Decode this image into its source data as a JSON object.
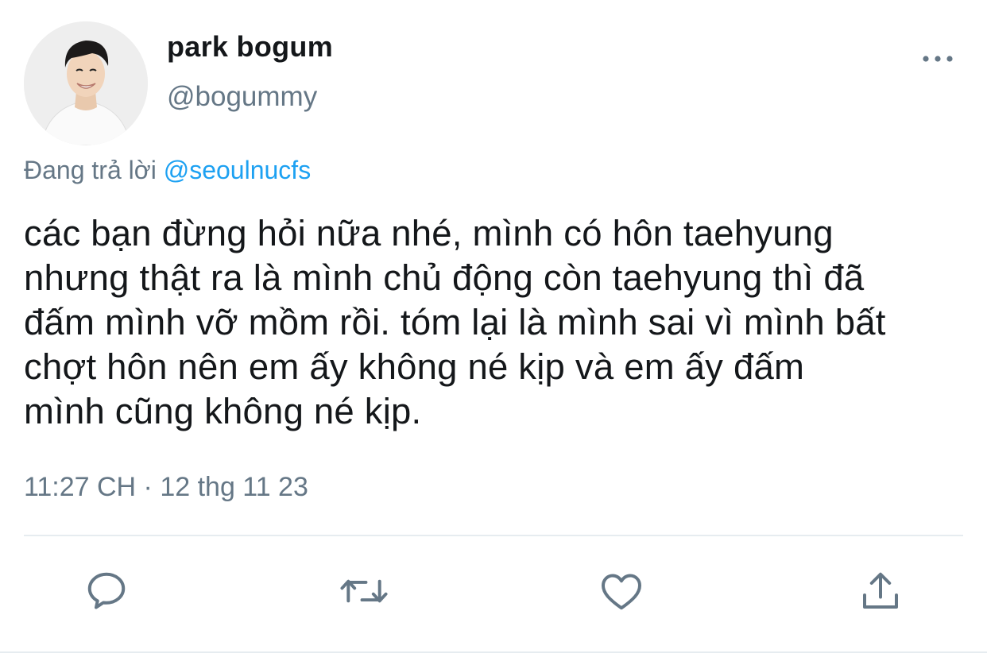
{
  "author": {
    "display_name": "park bogum",
    "handle": "@bogummy"
  },
  "reply": {
    "prefix": "Đang trả lời",
    "mention": "@seoulnucfs"
  },
  "tweet": {
    "text": "các bạn đừng hỏi nữa nhé, mình có hôn taehyung\nnhưng thật ra là mình chủ động còn taehyung thì đã\nđấm mình vỡ mồm rồi. tóm lại là mình sai vì mình bất\nchợt hôn nên em ấy không né kịp và em ấy đấm\nmình cũng không né kịp.",
    "timestamp": "11:27 CH · 12 thg 11 23"
  },
  "actions": {
    "icons": [
      "reply-icon",
      "retweet-icon",
      "like-icon",
      "share-icon"
    ]
  },
  "colors": {
    "text_primary": "#14171a",
    "text_secondary": "#657786",
    "accent": "#1da1f2",
    "divider": "#e6ecf0"
  }
}
